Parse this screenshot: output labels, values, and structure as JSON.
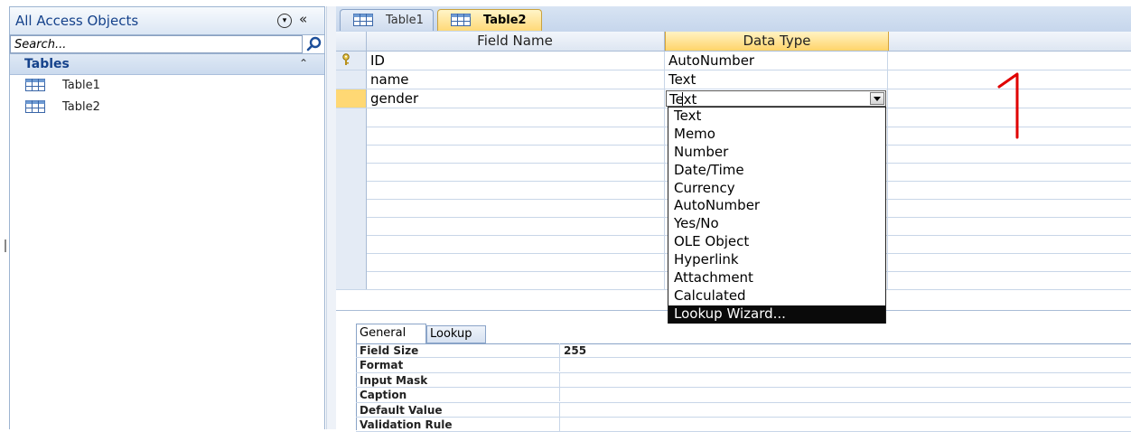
{
  "nav": {
    "title": "All Access Objects",
    "menu_glyph": "▾",
    "collapse_glyph": "«",
    "search_placeholder": "Search...",
    "group": {
      "label": "Tables",
      "chevron": "⌃"
    },
    "items": [
      {
        "label": "Table1"
      },
      {
        "label": "Table2"
      }
    ]
  },
  "tabs": [
    {
      "label": "Table1",
      "active": false
    },
    {
      "label": "Table2",
      "active": true
    }
  ],
  "grid": {
    "headers": {
      "field_name": "Field Name",
      "data_type": "Data Type"
    },
    "rows": [
      {
        "field_name": "ID",
        "data_type": "AutoNumber",
        "primary_key": true
      },
      {
        "field_name": "name",
        "data_type": "Text"
      },
      {
        "field_name": "gender",
        "data_type": "Text",
        "current": true
      }
    ]
  },
  "data_type_dropdown": {
    "options": [
      "Text",
      "Memo",
      "Number",
      "Date/Time",
      "Currency",
      "AutoNumber",
      "Yes/No",
      "OLE Object",
      "Hyperlink",
      "Attachment",
      "Calculated",
      "Lookup Wizard..."
    ],
    "highlighted": "Lookup Wizard..."
  },
  "annotation": {
    "text": "1",
    "color": "#e00000"
  },
  "field_properties": {
    "tabs": [
      "General",
      "Lookup"
    ],
    "rows": [
      {
        "name": "Field Size",
        "value": "255"
      },
      {
        "name": "Format",
        "value": ""
      },
      {
        "name": "Input Mask",
        "value": ""
      },
      {
        "name": "Caption",
        "value": ""
      },
      {
        "name": "Default Value",
        "value": ""
      },
      {
        "name": "Validation Rule",
        "value": ""
      }
    ]
  },
  "colors": {
    "accent_tab": "#ffd978",
    "header_blue": "#15428b",
    "selection": "#0a0a0a"
  }
}
